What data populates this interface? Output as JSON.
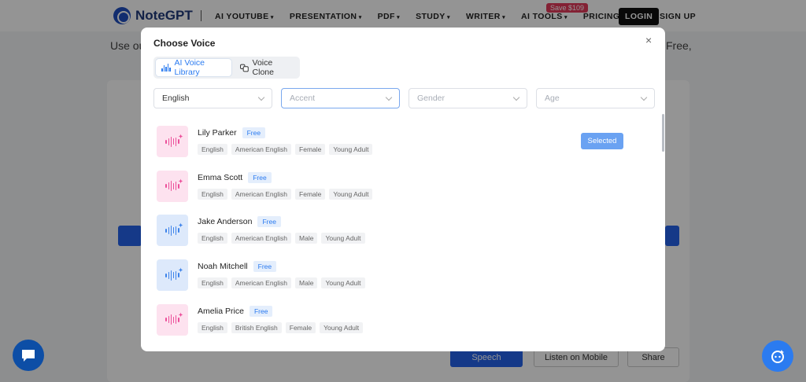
{
  "nav": {
    "logo": "NoteGPT",
    "items": [
      "AI YOUTUBE",
      "PRESENTATION",
      "PDF",
      "STUDY",
      "WRITER",
      "AI TOOLS",
      "PRICING"
    ],
    "save_badge": "Save $109",
    "login": "LOGIN",
    "signup": "SIGN UP"
  },
  "background": {
    "intro_left": "Use ou",
    "intro_right": "Free,",
    "speech_label": "Speech",
    "listen_mobile_label": "Listen on Mobile",
    "share_label": "Share"
  },
  "modal": {
    "title": "Choose Voice",
    "close": "×",
    "tabs": [
      {
        "label": "AI Voice Library",
        "active": true
      },
      {
        "label": "Voice Clone",
        "active": false
      }
    ],
    "filters": {
      "language": "English",
      "accent": "Accent",
      "gender": "Gender",
      "age": "Age"
    },
    "free_label": "Free",
    "selected_label": "Selected",
    "voices": [
      {
        "name": "Lily Parker",
        "tags": [
          "English",
          "American English",
          "Female",
          "Young Adult"
        ],
        "color": "pink",
        "selected": true
      },
      {
        "name": "Emma Scott",
        "tags": [
          "English",
          "American English",
          "Female",
          "Young Adult"
        ],
        "color": "pink",
        "selected": false
      },
      {
        "name": "Jake Anderson",
        "tags": [
          "English",
          "American English",
          "Male",
          "Young Adult"
        ],
        "color": "blue",
        "selected": false
      },
      {
        "name": "Noah Mitchell",
        "tags": [
          "English",
          "American English",
          "Male",
          "Young Adult"
        ],
        "color": "blue",
        "selected": false
      },
      {
        "name": "Amelia Price",
        "tags": [
          "English",
          "British English",
          "Female",
          "Young Adult"
        ],
        "color": "pink",
        "selected": false
      }
    ]
  },
  "colors": {
    "accent": "#2b7bf0",
    "pink_icon": "#ec4f9a",
    "blue_icon": "#3d83ea"
  }
}
